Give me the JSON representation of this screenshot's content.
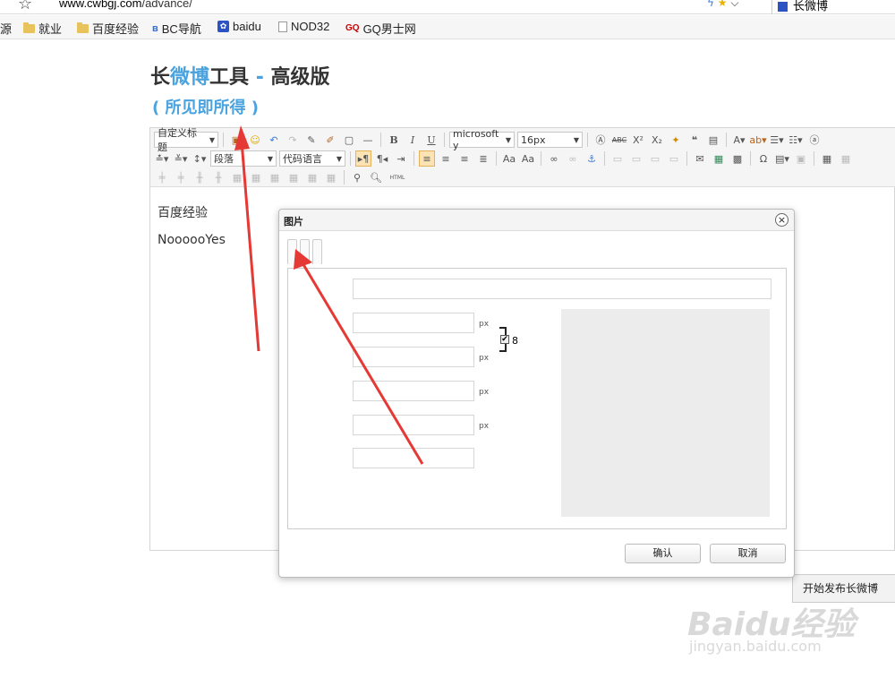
{
  "browser": {
    "url_host": "www.cwbgj.com",
    "url_path": "/advance/",
    "tab_title": "长微博"
  },
  "bookmarks": [
    {
      "label": "源",
      "icon": "none"
    },
    {
      "label": "就业",
      "icon": "folder-icon"
    },
    {
      "label": "百度经验",
      "icon": "folder-icon"
    },
    {
      "label": "BC导航",
      "icon": "bc-icon"
    },
    {
      "label": "baidu",
      "icon": "baidu-paw-icon"
    },
    {
      "label": "NOD32",
      "icon": "page-icon"
    },
    {
      "label": "GQ男士网",
      "icon": "gq-icon"
    }
  ],
  "page": {
    "title_part1": "长",
    "title_part2": "微博",
    "title_part3": "工具",
    "title_part4": " - ",
    "title_part5": "高级版",
    "subtitle": "( 所见即所得 )"
  },
  "toolbar": {
    "heading_combo": "自定义标题",
    "font_combo": "microsoft y",
    "size_combo": "16px",
    "paragraph_combo": "段落",
    "code_combo": "代码语言",
    "bold": "B",
    "italic": "I",
    "underline": "U",
    "html_label": "HTML"
  },
  "editor": {
    "lines": [
      "百度经验",
      "NoooooYes"
    ]
  },
  "dialog": {
    "title": "图片",
    "px_label": "px",
    "ok_label": "确认",
    "cancel_label": "取消"
  },
  "publish_label": "开始发布长微博",
  "watermark": {
    "brand": "Baidu经验",
    "url": "jingyan.baidu.com"
  },
  "colors": {
    "accent_blue": "#4aa3df",
    "annotation_red": "#e53935"
  }
}
